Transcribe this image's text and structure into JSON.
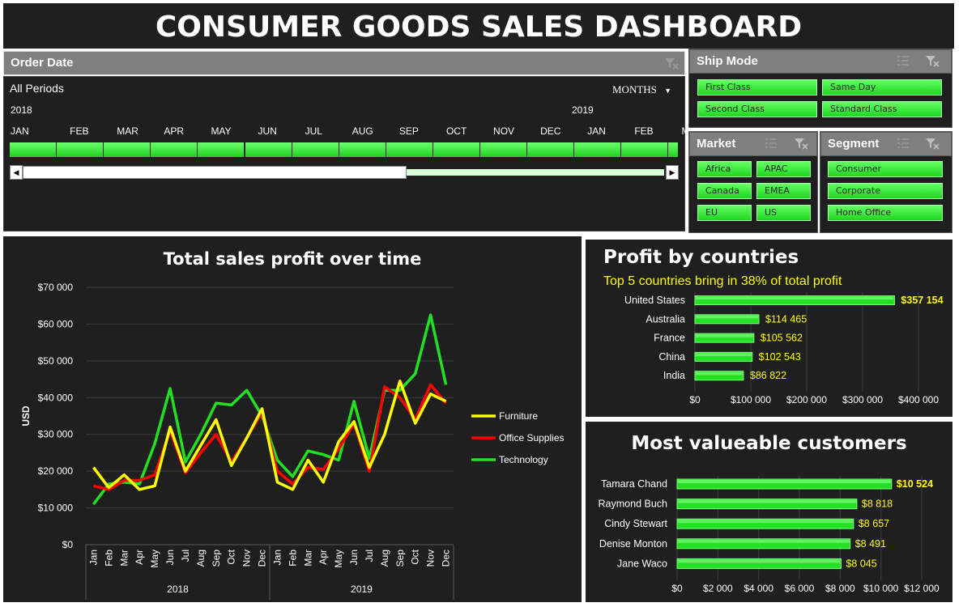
{
  "title": "CONSUMER GOODS SALES DASHBOARD",
  "timeline": {
    "header": "Order Date",
    "period": "All Periods",
    "level": "MONTHS",
    "year1": "2018",
    "year2": "2019",
    "months": [
      "JAN",
      "FEB",
      "MAR",
      "APR",
      "MAY",
      "JUN",
      "JUL",
      "AUG",
      "SEP",
      "OCT",
      "NOV",
      "DEC",
      "JAN",
      "FEB",
      "MA"
    ]
  },
  "slicers": {
    "ship_mode": {
      "title": "Ship Mode",
      "items": [
        "First Class",
        "Same Day",
        "Second Class",
        "Standard Class"
      ]
    },
    "market": {
      "title": "Market",
      "items": [
        "Africa",
        "APAC",
        "Canada",
        "EMEA",
        "EU",
        "US"
      ]
    },
    "segment": {
      "title": "Segment",
      "items": [
        "Consumer",
        "Corporate",
        "Home Office"
      ]
    }
  },
  "colors": {
    "background": "#1f1f1f",
    "green": "#22e022",
    "furniture": "#ffff00",
    "office": "#ff0000",
    "technology": "#22e022",
    "label_yellow": "#ffff00"
  },
  "chart_data": [
    {
      "type": "line",
      "title": "Total sales profit over time",
      "ylabel": "USD",
      "xlabel": "",
      "ylim": [
        0,
        70000
      ],
      "yticks": [
        "$70 000",
        "$60 000",
        "$50 000",
        "$40 000",
        "$30 000",
        "$20 000",
        "$10 000",
        "$0"
      ],
      "categories": [
        "Jan",
        "Feb",
        "Mar",
        "Apr",
        "May",
        "Jun",
        "Jul",
        "Aug",
        "Sep",
        "Oct",
        "Nov",
        "Dec",
        "Jan",
        "Feb",
        "Mar",
        "Apr",
        "May",
        "Jun",
        "Jul",
        "Aug",
        "Sep",
        "Oct",
        "Nov",
        "Dec"
      ],
      "groups": [
        "2018",
        "2019"
      ],
      "legend": "right",
      "series": [
        {
          "name": "Furniture",
          "values": [
            21000,
            15500,
            19000,
            15000,
            16000,
            32000,
            20000,
            27000,
            34000,
            21500,
            29000,
            37000,
            17000,
            15000,
            23000,
            17000,
            28000,
            33500,
            21000,
            30000,
            44500,
            33000,
            41000,
            39000
          ]
        },
        {
          "name": "Office Supplies",
          "values": [
            16000,
            15000,
            17500,
            17500,
            19000,
            31000,
            19500,
            25000,
            30000,
            22500,
            29000,
            36000,
            20000,
            16500,
            21000,
            20500,
            26000,
            33000,
            20000,
            43000,
            40000,
            34000,
            43500,
            38500
          ]
        },
        {
          "name": "Technology",
          "values": [
            11000,
            16500,
            17000,
            16500,
            27500,
            42500,
            22500,
            30000,
            38500,
            38000,
            42000,
            35000,
            23000,
            18500,
            25500,
            24500,
            23000,
            39000,
            23500,
            42000,
            42000,
            46500,
            62500,
            43500
          ]
        }
      ]
    },
    {
      "type": "bar",
      "title": "Profit by countries",
      "subtitle": "Top 5 countries bring in 38% of total profit",
      "categories": [
        "United States",
        "Australia",
        "France",
        "China",
        "India"
      ],
      "values": [
        357154,
        114465,
        105562,
        102543,
        86822
      ],
      "value_labels": [
        "$357 154",
        "$114 465",
        "$105 562",
        "$102 543",
        "$86 822"
      ],
      "xlim": [
        0,
        400000
      ],
      "xticks": [
        "$0",
        "$100 000",
        "$200 000",
        "$300 000",
        "$400 000"
      ]
    },
    {
      "type": "bar",
      "title": "Most valueable customers",
      "categories": [
        "Tamara Chand",
        "Raymond Buch",
        "Cindy Stewart",
        "Denise Monton",
        "Jane Waco"
      ],
      "values": [
        10524,
        8818,
        8657,
        8491,
        8045
      ],
      "value_labels": [
        "$10 524",
        "$8 818",
        "$8 657",
        "$8 491",
        "$8 045"
      ],
      "xlim": [
        0,
        12000
      ],
      "xticks": [
        "$0",
        "$2 000",
        "$4 000",
        "$6 000",
        "$8 000",
        "$10 000",
        "$12 000"
      ]
    }
  ]
}
